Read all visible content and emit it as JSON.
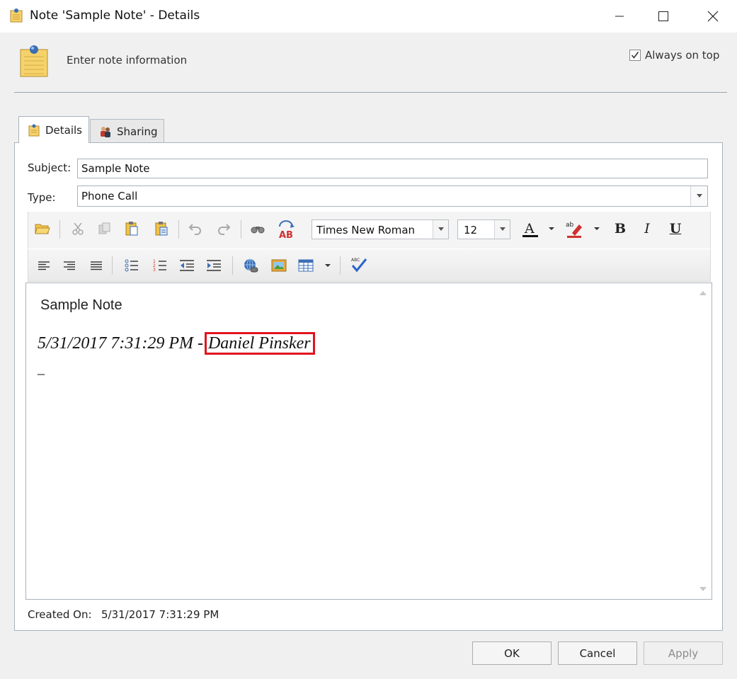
{
  "window": {
    "title": "Note 'Sample Note' - Details"
  },
  "header": {
    "text": "Enter note information",
    "always_on_top_label": "Always on top",
    "always_on_top_checked": true
  },
  "tabs": [
    {
      "label": "Details",
      "active": true
    },
    {
      "label": "Sharing",
      "active": false
    }
  ],
  "form": {
    "subject_label": "Subject:",
    "subject_value": "Sample Note",
    "type_label": "Type:",
    "type_value": "Phone Call"
  },
  "toolbar": {
    "font_name": "Times New Roman",
    "font_size": "12",
    "bold_label": "B",
    "italic_label": "I",
    "underline_label": "U",
    "font_color_letter": "A",
    "spell_letters": "AB"
  },
  "editor": {
    "title": "Sample Note",
    "timestamp": "5/31/2017 7:31:29 PM -",
    "author": "Daniel Pinsker",
    "cursor": "_"
  },
  "footer": {
    "created_label": "Created On:",
    "created_value": "5/31/2017 7:31:29 PM"
  },
  "buttons": {
    "ok": "OK",
    "cancel": "Cancel",
    "apply": "Apply"
  },
  "colors": {
    "highlight_box": "#e0141e",
    "note_yellow": "#f6d36a"
  }
}
